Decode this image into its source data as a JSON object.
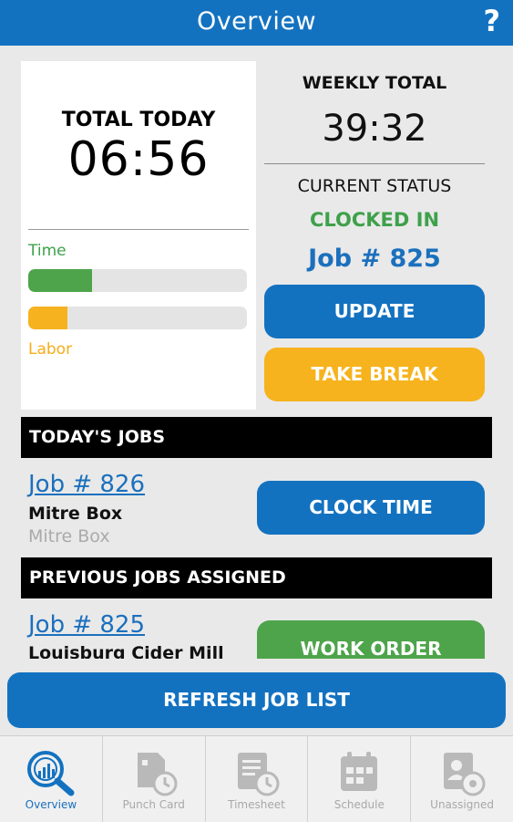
{
  "header": {
    "title": "Overview",
    "help_label": "?"
  },
  "today": {
    "label": "TOTAL TODAY",
    "time": "06:56",
    "time_bar_label": "Time",
    "labor_bar_label": "Labor",
    "time_progress": 0.29,
    "labor_progress": 0.18
  },
  "weekly": {
    "label": "WEEKLY TOTAL",
    "time": "39:32"
  },
  "status": {
    "label": "CURRENT STATUS",
    "value": "CLOCKED IN",
    "job": "Job # 825"
  },
  "actions": {
    "update": "UPDATE",
    "take_break": "TAKE BREAK"
  },
  "todays_jobs": {
    "title": "TODAY'S JOBS",
    "items": [
      {
        "job": "Job # 826",
        "name": "Mitre Box",
        "subtitle": "Mitre Box",
        "button": "CLOCK TIME"
      }
    ]
  },
  "previous_jobs": {
    "title": "PREVIOUS JOBS ASSIGNED",
    "items": [
      {
        "job": "Job # 825",
        "name": "Louisburg Cider Mill",
        "button": "WORK ORDER"
      }
    ]
  },
  "refresh_label": "REFRESH JOB LIST",
  "tabs": [
    {
      "label": "Overview",
      "icon": "overview-icon",
      "active": true
    },
    {
      "label": "Punch Card",
      "icon": "punch-card-icon",
      "active": false
    },
    {
      "label": "Timesheet",
      "icon": "timesheet-icon",
      "active": false
    },
    {
      "label": "Schedule",
      "icon": "schedule-icon",
      "active": false
    },
    {
      "label": "Unassigned",
      "icon": "unassigned-icon",
      "active": false
    }
  ],
  "colors": {
    "primary": "#1372c0",
    "green": "#4ea44b",
    "orange": "#f6b31d",
    "inactive": "#a8a8a8"
  }
}
